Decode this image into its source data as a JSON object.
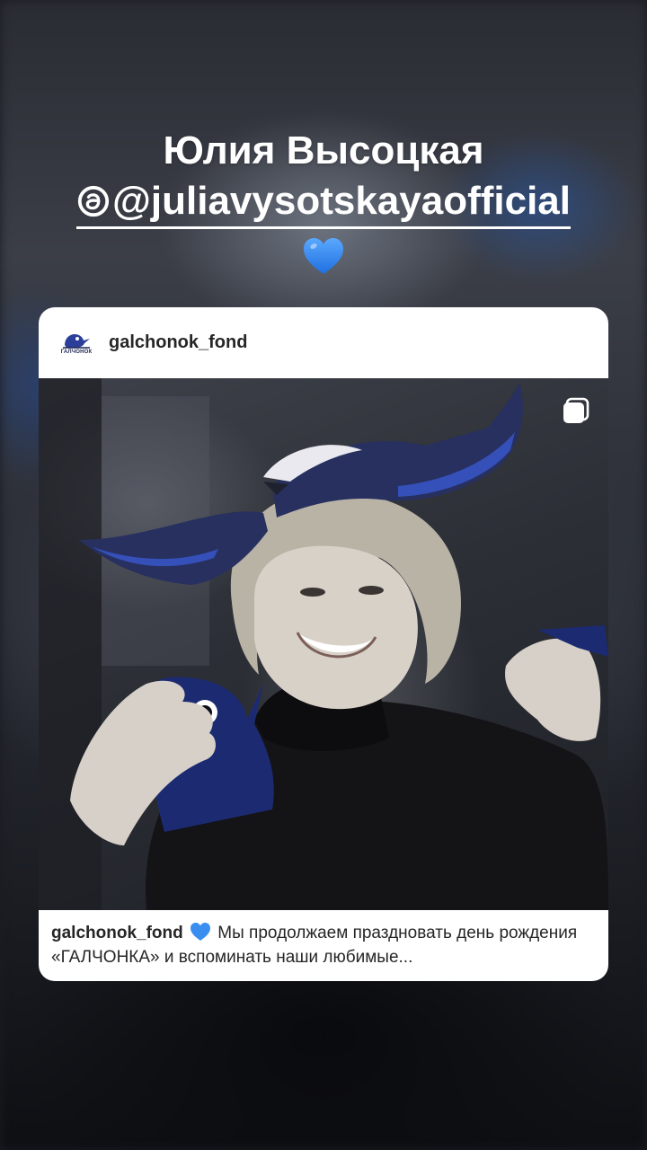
{
  "story": {
    "title": "Юлия Высоцкая",
    "handle": "@juliavysotskayaofficial",
    "heart_emoji": "💙"
  },
  "post": {
    "username": "galchonok_fond",
    "avatar_text": "ГАЛЧОНОК",
    "caption_username": "galchonok_fond",
    "caption_emoji": "💙",
    "caption_text": "Мы продолжаем праздновать день рождения «ГАЛЧОНКА» и вспоминать наши любимые..."
  },
  "colors": {
    "heart_blue": "#3a8ef0",
    "brand_navy": "#1d2550",
    "wing_blue": "#2b3f9a"
  },
  "icons": [
    "threads-icon",
    "blue-heart-icon",
    "multiple-posts-icon"
  ]
}
